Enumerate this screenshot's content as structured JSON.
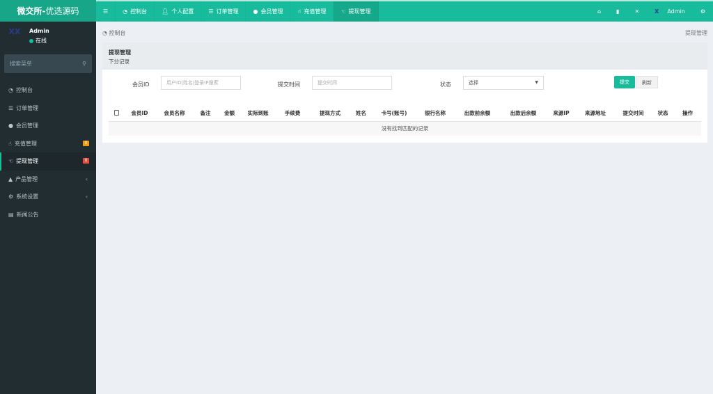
{
  "brand": {
    "name_bold": "微交所-",
    "name_rest": "优选源码"
  },
  "topnav": {
    "items": [
      {
        "label": "控制台",
        "icon": "dashboard-icon"
      },
      {
        "label": "个人配置",
        "icon": "user-icon"
      },
      {
        "label": "订单管理",
        "icon": "list-icon"
      },
      {
        "label": "会员管理",
        "icon": "users-icon"
      },
      {
        "label": "充值管理",
        "icon": "hand-icon"
      },
      {
        "label": "提现管理",
        "icon": "hand-icon",
        "active": true
      }
    ],
    "user": "Admin"
  },
  "sidebar": {
    "user": {
      "name": "Admin",
      "status": "在线"
    },
    "search_placeholder": "搜索菜单",
    "items": [
      {
        "label": "控制台"
      },
      {
        "label": "订单管理"
      },
      {
        "label": "会员管理"
      },
      {
        "label": "充值管理",
        "badge": "0",
        "badge_color": "#f39c12"
      },
      {
        "label": "提现管理",
        "badge": "0",
        "badge_color": "#e74c3c",
        "active": true
      },
      {
        "label": "产品管理"
      },
      {
        "label": "系统设置"
      },
      {
        "label": "新闻公告"
      }
    ]
  },
  "breadcrumb": {
    "home": "控制台",
    "current": "提现管理"
  },
  "panel": {
    "title": "提现管理",
    "subtitle": "下分记录"
  },
  "filters": {
    "member_label": "会员ID",
    "member_placeholder": "用户ID|姓名|登录IP搜索",
    "time_label": "提交时间",
    "time_placeholder": "提交时间",
    "status_label": "状态",
    "status_value": "选择",
    "submit": "提交",
    "refresh": "刷新"
  },
  "table": {
    "columns": [
      "会员ID",
      "会员名称",
      "备注",
      "金额",
      "实际到账",
      "手续费",
      "提现方式",
      "姓名",
      "卡号(账号)",
      "银行名称",
      "出款前余额",
      "出款后余额",
      "来源IP",
      "来源地址",
      "提交时间",
      "状态",
      "操作"
    ],
    "empty": "没有找到匹配的记录"
  },
  "colors": {
    "accent": "#18bc9c",
    "sidebar": "#222d32"
  }
}
